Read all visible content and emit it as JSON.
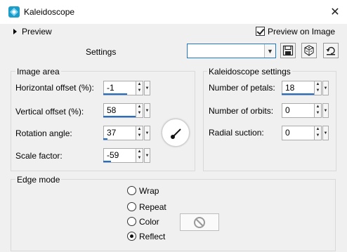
{
  "window": {
    "title": "Kaleidoscope",
    "close_glyph": "✕",
    "app_icon": "kaleidoscope-app-icon"
  },
  "preview": {
    "label": "Preview",
    "preview_on_image_label": "Preview on Image",
    "preview_on_image_checked": true
  },
  "settings": {
    "label": "Settings",
    "preset_value": ""
  },
  "toolbar": {
    "icons": [
      "save-icon",
      "randomize-icon",
      "reset-icon"
    ]
  },
  "image_area": {
    "title": "Image area",
    "fields": [
      {
        "label": "Horizontal offset (%):",
        "value": "-1"
      },
      {
        "label": "Vertical offset (%):",
        "value": "58"
      },
      {
        "label": "Rotation angle:",
        "value": "37"
      },
      {
        "label": "Scale factor:",
        "value": "-59"
      }
    ],
    "level_fractions": [
      0.7,
      0.97,
      0.12,
      0.22
    ]
  },
  "kaleidoscope_settings": {
    "title": "Kaleidoscope settings",
    "fields": [
      {
        "label": "Number of petals:",
        "value": "18"
      },
      {
        "label": "Number of orbits:",
        "value": "0"
      },
      {
        "label": "Radial suction:",
        "value": "0"
      }
    ],
    "level_fractions": [
      0.97,
      0.0,
      0.0
    ]
  },
  "edge_mode": {
    "title": "Edge mode",
    "options": [
      "Wrap",
      "Repeat",
      "Color",
      "Reflect"
    ],
    "selected": "Reflect"
  },
  "colors": {
    "accent": "#1f6fd0",
    "app_icon": "#1c9cc9"
  }
}
